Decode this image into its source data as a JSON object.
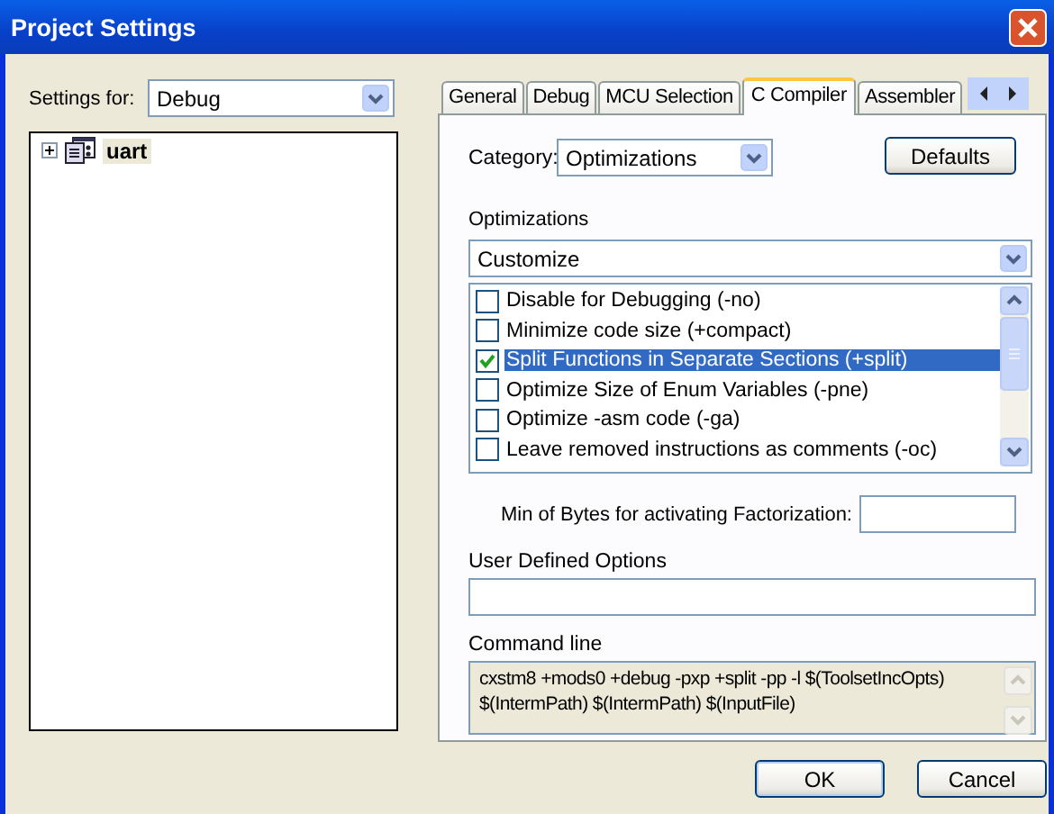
{
  "window": {
    "title": "Project Settings"
  },
  "settings_for": {
    "label": "Settings for:",
    "value": "Debug"
  },
  "tree": [
    {
      "label": "uart",
      "expanded": false,
      "selected": true
    }
  ],
  "tabs": [
    {
      "label": "General",
      "selected": false
    },
    {
      "label": "Debug",
      "selected": false
    },
    {
      "label": "MCU Selection",
      "selected": false
    },
    {
      "label": "C Compiler",
      "selected": true
    },
    {
      "label": "Assembler",
      "selected": false
    }
  ],
  "category": {
    "label": "Category:",
    "value": "Optimizations"
  },
  "defaults_button": "Defaults",
  "optimizations": {
    "label": "Optimizations",
    "value": "Customize",
    "options": [
      {
        "label": "Disable for Debugging (-no)",
        "checked": false,
        "selected": false
      },
      {
        "label": "Minimize code size (+compact)",
        "checked": false,
        "selected": false
      },
      {
        "label": "Split Functions in Separate Sections (+split)",
        "checked": true,
        "selected": true
      },
      {
        "label": "Optimize Size of Enum Variables (-pne)",
        "checked": false,
        "selected": false
      },
      {
        "label": "Optimize -asm code (-ga)",
        "checked": false,
        "selected": false
      },
      {
        "label": "Leave removed instructions as comments (-oc)",
        "checked": false,
        "selected": false
      }
    ]
  },
  "min_bytes": {
    "label": "Min of Bytes for activating Factorization:"
  },
  "user_defined_options": {
    "label": "User Defined Options"
  },
  "command_line": {
    "label": "Command line",
    "value": "cxstm8 +mods0 +debug -pxp +split -pp -l $(ToolsetIncOpts) $(IntermPath) $(IntermPath) $(InputFile)"
  },
  "buttons": [
    "OK",
    "Cancel"
  ]
}
